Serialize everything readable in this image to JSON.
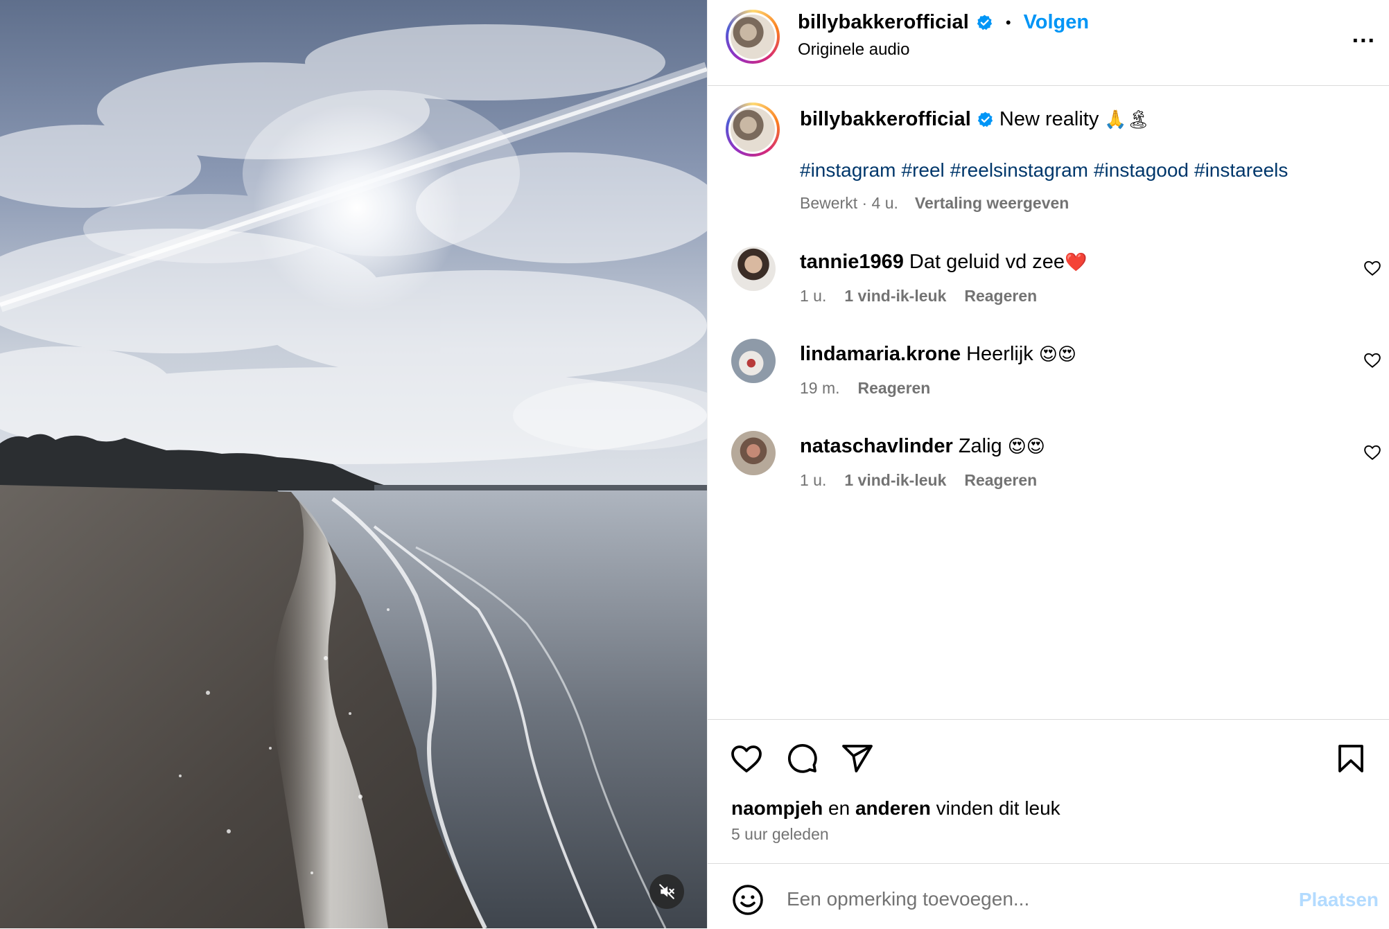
{
  "post": {
    "author": "billybakkerofficial",
    "separator": "•",
    "follow_label": "Volgen",
    "audio_label": "Originele audio",
    "more_label": "...",
    "caption_text": "New reality",
    "caption_emoji": "🙏🏝",
    "hashtags": [
      "#instagram",
      "#reel",
      "#reelsinstagram",
      "#instagood",
      "#instareels"
    ],
    "caption_meta": {
      "edited": "Bewerkt · 4 u.",
      "translate": "Vertaling weergeven"
    }
  },
  "comments": [
    {
      "user": "tannie1969",
      "text": "Dat geluid vd zee",
      "emoji": "❤️",
      "time": "1 u.",
      "likes": "1 vind-ik-leuk",
      "reply": "Reageren"
    },
    {
      "user": "lindamaria.krone",
      "text": "Heerlijk",
      "emoji": "😍😍",
      "time": "19 m.",
      "likes": "",
      "reply": "Reageren"
    },
    {
      "user": "nataschavlinder",
      "text": "Zalig",
      "emoji": "😍😍",
      "time": "1 u.",
      "likes": "1 vind-ik-leuk",
      "reply": "Reageren"
    }
  ],
  "engagement": {
    "liked_by_user": "naompjeh",
    "liked_by_connector": "en",
    "liked_by_others": "anderen",
    "liked_by_suffix": "vinden dit leuk",
    "posted_ago": "5 uur geleden"
  },
  "composer": {
    "placeholder": "Een opmerking toevoegen...",
    "post_label": "Plaatsen"
  },
  "icons": {
    "like": "heart-icon",
    "comment": "comment-icon",
    "share": "share-icon",
    "save": "bookmark-icon",
    "emoji": "emoji-icon",
    "mute": "muted-speaker-icon",
    "verified": "verified-badge-icon"
  },
  "colors": {
    "accent": "#0095f6",
    "hashtag": "#00376b",
    "secondary_text": "#737373",
    "post_disabled": "#b3dbff",
    "verified": "#0095f6"
  }
}
